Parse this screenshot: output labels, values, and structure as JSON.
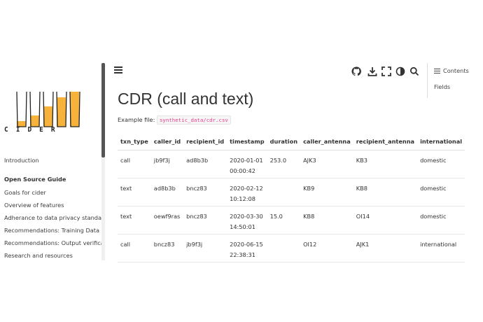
{
  "logo": {
    "text": "CIDER"
  },
  "sidebar": {
    "intro": "Introduction",
    "caption": "Open Source Guide",
    "items": [
      "Goals for cider",
      "Overview of features",
      "Adherance to data privacy standards",
      "Recommendations: Training Data",
      "Recommendations: Output verification",
      "Research and resources"
    ]
  },
  "toolbar": {
    "icons": [
      "menu-icon",
      "github-icon",
      "download-icon",
      "fullscreen-icon",
      "theme-toggle-icon",
      "search-icon"
    ]
  },
  "toc": {
    "title": "Contents",
    "items": [
      "Fields"
    ]
  },
  "main": {
    "title": "CDR (call and text)",
    "example_label": "Example file:",
    "example_file": "synthetic_data/cdr.csv"
  },
  "table": {
    "headers": [
      "txn_type",
      "caller_id",
      "recipient_id",
      "timestamp",
      "duration",
      "caller_antenna",
      "recipient_antenna",
      "international"
    ],
    "rows": [
      [
        "call",
        "jb9f3j",
        "ad8b3b",
        "2020-01-01 00:00:42",
        "253.0",
        "AJK3",
        "KB3",
        "domestic"
      ],
      [
        "text",
        "ad8b3b",
        "bncz83",
        "2020-02-12 10:12:08",
        "",
        "KB9",
        "KB8",
        "domestic"
      ],
      [
        "text",
        "oewf9ras",
        "bncz83",
        "2020-03-30 14:50:01",
        "15.0",
        "KB8",
        "OI14",
        "domestic"
      ],
      [
        "call",
        "bncz83",
        "jb9f3j",
        "2020-06-15 22:38:31",
        "",
        "OI12",
        "AJK1",
        "international"
      ]
    ]
  },
  "colors": {
    "accent_code": "#e83e8c",
    "logo_fill": "#f7b23b",
    "text": "#333333"
  }
}
